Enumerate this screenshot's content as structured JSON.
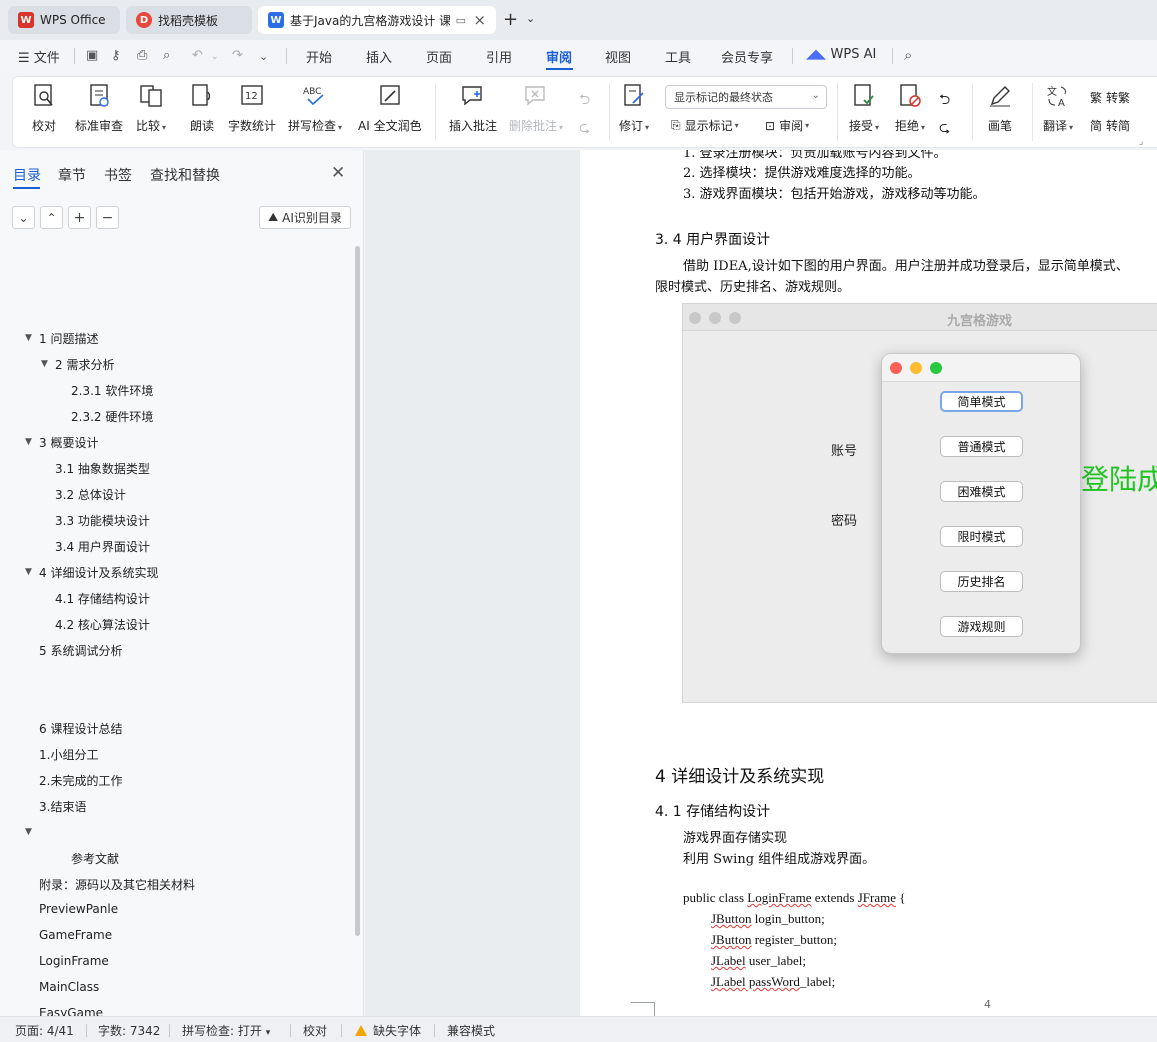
{
  "tabs": [
    {
      "label": "WPS Office",
      "logo": "W"
    },
    {
      "label": "找稻壳模板",
      "logo": "D"
    },
    {
      "label": "基于Java的九宫格游戏设计 课",
      "logo": "W"
    }
  ],
  "menu": [
    "文件",
    "开始",
    "插入",
    "页面",
    "引用",
    "审阅",
    "视图",
    "工具",
    "会员专享",
    "WPS AI"
  ],
  "ribbon": {
    "buttons": [
      "校对",
      "标准审查",
      "比较",
      "朗读",
      "字数统计",
      "拼写检查",
      "AI 全文润色",
      "插入批注",
      "删除批注",
      "修订",
      "接受",
      "拒绝",
      "画笔",
      "翻译"
    ],
    "markup_select": "显示标记的最终状态",
    "show_markup": "显示标记",
    "review": "审阅",
    "to_traditional": "转繁",
    "to_simplified": "转简"
  },
  "nav": {
    "tabs": [
      "目录",
      "章节",
      "书签",
      "查找和替换"
    ],
    "ai_toc": "AI识别目录",
    "toc": [
      "1  问题描述",
      "2  需求分析",
      "2.3.1 软件环境",
      "2.3.2 硬件环境",
      "3  概要设计",
      "3.1 抽象数据类型",
      "3.2  总体设计",
      "3.3  功能模块设计",
      "3.4  用户界面设计",
      "4  详细设计及系统实现",
      "4.1  存储结构设计",
      "4.2  核心算法设计",
      "5  系统调试分析",
      "6  课程设计总结",
      "1.小组分工",
      "2.未完成的工作",
      "3.结束语",
      "参考文献",
      "附录：源码以及其它相关材料",
      "PreviewPanle",
      "GameFrame",
      "LoginFrame",
      "MainClass",
      "EasyGame"
    ]
  },
  "doc": {
    "line_top": "1. 登录注册模块：负责加载账号内容到文件。",
    "line2": "2.  选择模块：提供游戏难度选择的功能。",
    "line3": "3.  游戏界面模块：包括开始游戏，游戏移动等功能。",
    "h34": "3. 4  用户界面设计",
    "para1": "借助 IDEA,设计如下图的用户界面。用户注册并成功登录后，显示简单模式、",
    "para2": "限时模式、历史排名、游戏规则。",
    "h4": "4  详细设计及系统实现",
    "h41": "4. 1  存储结构设计",
    "s1": "游戏界面存储实现",
    "s2": "利用 Swing 组件组成游戏界面。",
    "code": [
      [
        "public class ",
        "LoginFrame",
        " extends ",
        "JFrame",
        " {"
      ],
      [
        "JButton",
        " login_button;"
      ],
      [
        "JButton",
        " register_button;"
      ],
      [
        "JLabel",
        " user_label;"
      ],
      [
        "JLabel",
        " passWord",
        "_label;"
      ]
    ],
    "page_number": "4"
  },
  "game": {
    "window_title": "九宫格游戏",
    "account": "账号",
    "password": "密码",
    "login_success": "登陆成",
    "modes": [
      "简单模式",
      "普通模式",
      "困难模式",
      "限时模式",
      "历史排名",
      "游戏规则"
    ]
  },
  "status": {
    "page": "页面: 4/41",
    "words": "字数: 7342",
    "spell": "拼写检查: 打开",
    "proof": "校对",
    "missing_font": "缺失字体",
    "compat": "兼容模式"
  },
  "colors": {
    "accent": "#1a5fd6",
    "success_text": "#22c422",
    "wps_red": "#d9342b"
  }
}
